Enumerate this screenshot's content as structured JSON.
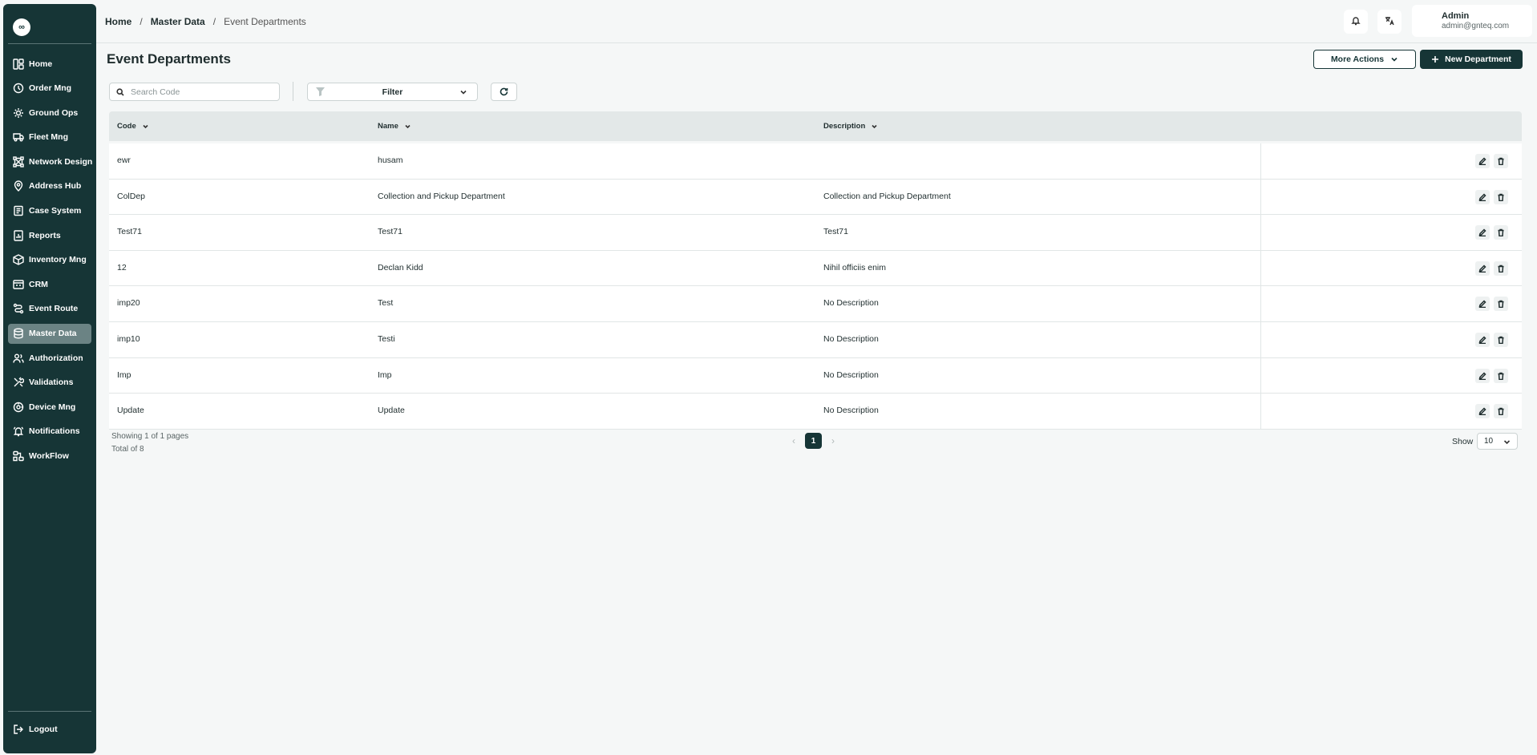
{
  "logo": {
    "glyph": "∞"
  },
  "sidebar": {
    "items": [
      {
        "label": "Home",
        "icon": "layout-icon",
        "active": false
      },
      {
        "label": "Order Mng",
        "icon": "order-icon",
        "active": false
      },
      {
        "label": "Ground Ops",
        "icon": "ground-ops-icon",
        "active": false
      },
      {
        "label": "Fleet Mng",
        "icon": "truck-icon",
        "active": false
      },
      {
        "label": "Network Design",
        "icon": "network-icon",
        "active": false
      },
      {
        "label": "Address Hub",
        "icon": "map-pin-icon",
        "active": false
      },
      {
        "label": "Case System",
        "icon": "case-icon",
        "active": false
      },
      {
        "label": "Reports",
        "icon": "report-icon",
        "active": false
      },
      {
        "label": "Inventory Mng",
        "icon": "inventory-icon",
        "active": false
      },
      {
        "label": "CRM",
        "icon": "crm-icon",
        "active": false
      },
      {
        "label": "Event Route",
        "icon": "route-icon",
        "active": false
      },
      {
        "label": "Master Data",
        "icon": "database-icon",
        "active": true
      },
      {
        "label": "Authorization",
        "icon": "users-icon",
        "active": false
      },
      {
        "label": "Validations",
        "icon": "tools-icon",
        "active": false
      },
      {
        "label": "Device Mng",
        "icon": "device-icon",
        "active": false
      },
      {
        "label": "Notifications",
        "icon": "bell-icon",
        "active": false
      },
      {
        "label": "WorkFlow",
        "icon": "workflow-icon",
        "active": false
      }
    ],
    "logout_label": "Logout"
  },
  "breadcrumb": {
    "home": "Home",
    "section": "Master Data",
    "current": "Event Departments",
    "separator": "/"
  },
  "user": {
    "name": "Admin",
    "email": "admin@gnteq.com"
  },
  "page": {
    "title": "Event Departments"
  },
  "toolbar": {
    "more_actions_label": "More Actions",
    "new_label": "New Department",
    "search_placeholder": "Search Code",
    "search_value": "",
    "filter_label": "Filter"
  },
  "table": {
    "columns": [
      "Code",
      "Name",
      "Description"
    ],
    "rows": [
      {
        "code": "ewr",
        "name": "husam",
        "description": ""
      },
      {
        "code": "ColDep",
        "name": "Collection and Pickup Department",
        "description": "Collection and Pickup Department"
      },
      {
        "code": "Test71",
        "name": "Test71",
        "description": "Test71"
      },
      {
        "code": "12",
        "name": "Declan Kidd",
        "description": "Nihil officiis enim"
      },
      {
        "code": "imp20",
        "name": "Test",
        "description": "No Description"
      },
      {
        "code": "imp10",
        "name": "Testi",
        "description": "No Description"
      },
      {
        "code": "Imp",
        "name": "Imp",
        "description": "No Description"
      },
      {
        "code": "Update",
        "name": "Update",
        "description": "No Description"
      }
    ]
  },
  "footer": {
    "showing": "Showing 1 of 1 pages",
    "total": "Total of 8",
    "page": "1",
    "prev": "‹",
    "next": "›",
    "show_label": "Show",
    "page_size": "10"
  },
  "colors": {
    "sidebar": "#163536",
    "active": "#6b8384",
    "accent": "#163536"
  }
}
